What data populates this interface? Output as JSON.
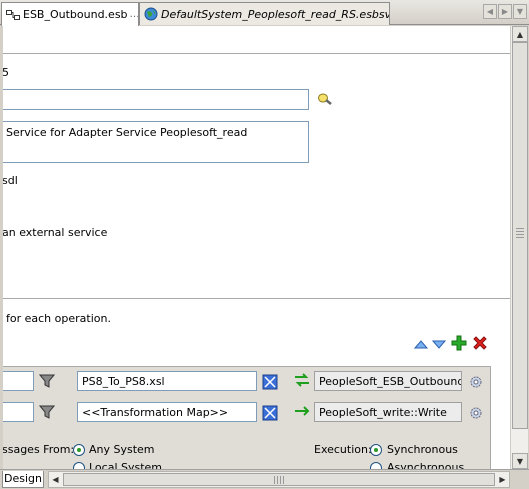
{
  "tabs": [
    {
      "label": "ESB_Outbound.esb",
      "close": "…",
      "icon": "esb-diagram-icon"
    },
    {
      "label": "DefaultSystem_Peoplesoft_read_RS.esbsvc",
      "icon": "globe-service-icon"
    }
  ],
  "form": {
    "name_fragment": "5",
    "description": "Service for Adapter Service Peoplesoft_read",
    "wsdl_fragment": "sdl",
    "invoke_fragment": "an external service",
    "operations_hint": "for each operation."
  },
  "routing_rules": [
    {
      "xsl": "PS8_To_PS8.xsl",
      "target": "PeopleSoft_ESB_Outbound::I",
      "arrow": "bidirectional"
    },
    {
      "xsl": "<<Transformation Map>>",
      "target": "PeopleSoft_write::Write",
      "arrow": "one-way"
    }
  ],
  "options": {
    "messages_from_label": "ssages From:",
    "messages_from_options": [
      "Any System",
      "Local System"
    ],
    "messages_from_selected": "Any System",
    "execution_label": "Execution:",
    "execution_options": [
      "Synchronous",
      "Asynchronous"
    ],
    "execution_selected": "Synchronous"
  },
  "bottom": {
    "design_tab": "Design"
  },
  "colors": {
    "accent_blue": "#3a6fd8",
    "add_green": "#1ea01e",
    "delete_red": "#d01818",
    "panel_gray": "#e0ddd7"
  }
}
